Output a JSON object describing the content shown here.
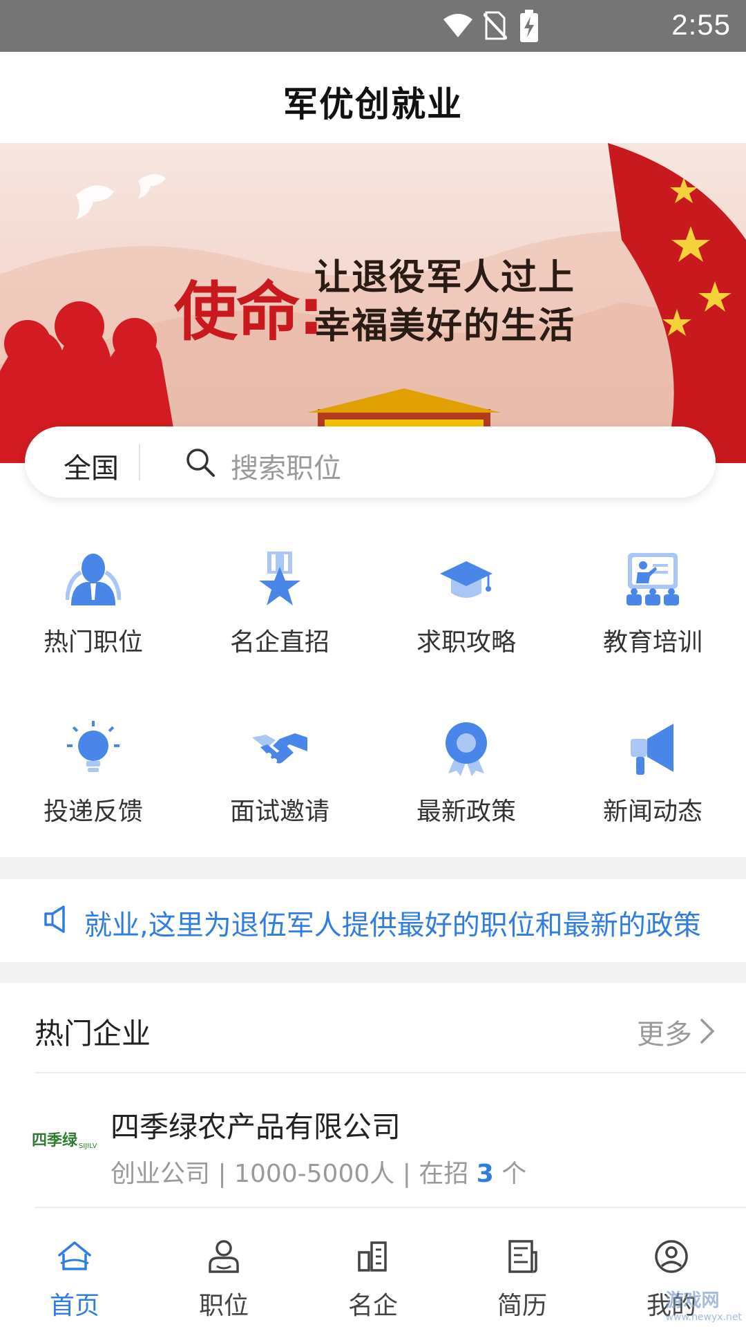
{
  "status_bar": {
    "time": "2:55",
    "icons": [
      "wifi-icon",
      "no-sim-icon",
      "battery-charging-icon"
    ]
  },
  "app_bar": {
    "title": "军优创就业"
  },
  "banner": {
    "mission": "使命:",
    "line1": "让退役军人过上",
    "line2": "幸福美好的生活"
  },
  "search": {
    "region": "全国",
    "placeholder": "搜索职位"
  },
  "grid_items": [
    {
      "label": "热门职位",
      "icon": "hot-jobs-icon"
    },
    {
      "label": "名企直招",
      "icon": "medal-star-icon"
    },
    {
      "label": "求职攻略",
      "icon": "graduation-cap-icon"
    },
    {
      "label": "教育培训",
      "icon": "teacher-board-icon"
    },
    {
      "label": "投递反馈",
      "icon": "lightbulb-icon"
    },
    {
      "label": "面试邀请",
      "icon": "handshake-icon"
    },
    {
      "label": "最新政策",
      "icon": "award-badge-icon"
    },
    {
      "label": "新闻动态",
      "icon": "megaphone-icon"
    }
  ],
  "notice": {
    "text": "就业,这里为退伍军人提供最好的职位和最新的政策",
    "icon": "speaker-icon"
  },
  "hot_companies": {
    "title": "热门企业",
    "more": "更多"
  },
  "companies": [
    {
      "name": "四季绿农产品有限公司",
      "type": "创业公司",
      "size": "1000-5000人",
      "hiring_prefix": "在招",
      "count": "3",
      "unit": "个",
      "logo_text": "四季绿",
      "logo_sub": "SIJILV"
    }
  ],
  "tabs": [
    {
      "label": "首页",
      "icon": "home-icon",
      "active": true
    },
    {
      "label": "职位",
      "icon": "person-icon",
      "active": false
    },
    {
      "label": "名企",
      "icon": "building-icon",
      "active": false
    },
    {
      "label": "简历",
      "icon": "resume-icon",
      "active": false
    },
    {
      "label": "我的",
      "icon": "profile-icon",
      "active": false
    }
  ],
  "watermark": {
    "text": "游戏网",
    "sub": "www.newyx.net"
  },
  "colors": {
    "accent": "#2f7de1",
    "icon_blue": "#4a86e8",
    "icon_light": "#a9c6f5",
    "banner_red": "#c8191f"
  }
}
